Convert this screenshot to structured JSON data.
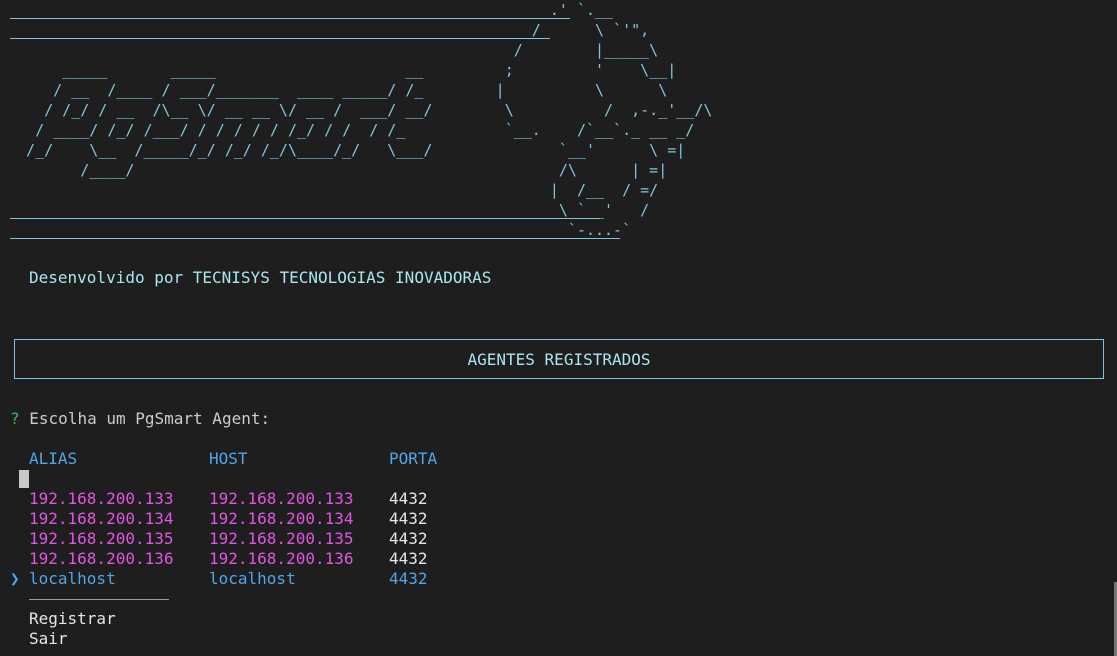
{
  "banner": {
    "art": "                                                            .' `.__ \n                                                          /      \\ `'\",\n                                                        /        |_____\\\n      _____       _____                     __         ;         '    \\__|\n     / __  /____ / ___/_______  ____ _____/ /_        |          \\      \\\n    / /_/ / __  /\\__ \\/ __ __ \\/ __ /  ___/ __/        \\          /  ,-._'__/\\\n   / ____/ /_/ /___/ / / / / / /_/ / /  / /_           `__.    /`__`._ __ _/\n  /_/    \\__  /_____/_/ /_/ /_/\\____/_/   \\___/              `__'      \\ =|\n        /____/                                               /\\      | =|\n                                                            |  /__  / =/\n                                                             \\ `__'   /\n                                                              `-...-`",
    "subtitle": "Desenvolvido por TECNISYS TECNOLOGIAS INOVADORAS"
  },
  "section_title": "AGENTES REGISTRADOS",
  "prompt": {
    "mark": "?",
    "text": "Escolha um PgSmart Agent:"
  },
  "table": {
    "headers": {
      "alias": "ALIAS",
      "host": "HOST",
      "port": "PORTA"
    },
    "rows": [
      {
        "alias": "192.168.200.133",
        "host": "192.168.200.133",
        "port": "4432"
      },
      {
        "alias": "192.168.200.134",
        "host": "192.168.200.134",
        "port": "4432"
      },
      {
        "alias": "192.168.200.135",
        "host": "192.168.200.135",
        "port": "4432"
      },
      {
        "alias": "192.168.200.136",
        "host": "192.168.200.136",
        "port": "4432"
      },
      {
        "alias": "localhost",
        "host": "localhost",
        "port": "4432"
      }
    ],
    "selected_marker": "❯"
  },
  "menu": {
    "register": "Registrar",
    "exit": "Sair"
  },
  "colors": {
    "background": "#1e1e1e",
    "banner": "#7ec6e0",
    "header": "#4fa6e8",
    "ip": "#e254e2",
    "prompt_mark": "#3fb950"
  }
}
